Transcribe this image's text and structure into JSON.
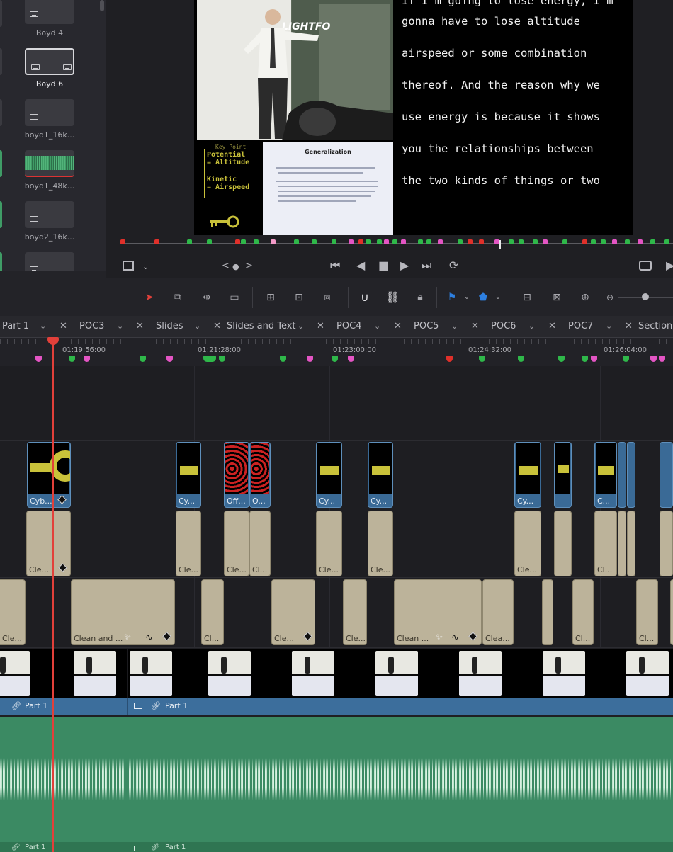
{
  "media_pool": {
    "items": [
      {
        "name": "Boyd 4",
        "kind": "subtitle"
      },
      {
        "name": "Boyd 6",
        "kind": "subtitle",
        "selected": true
      },
      {
        "name": "boyd1_16k...",
        "kind": "subtitle"
      },
      {
        "name": "boyd1_48k...",
        "kind": "audio"
      },
      {
        "name": "boyd2_16k...",
        "kind": "subtitle"
      }
    ]
  },
  "viewer": {
    "captions": [
      "If I'm going to lose energy, I'm",
      "gonna have to lose altitude",
      "airspeed or some combination",
      "thereof. And the reason why we",
      "use energy is because it shows",
      "you the relationships between",
      "the two kinds of things or two"
    ],
    "slide": {
      "title": "Generalization",
      "key_point": "Key Point",
      "potential": "Potential",
      "eq_altitude": "= Altitude",
      "kinetic": "Kinetic",
      "eq_airspeed": "= Airspeed"
    }
  },
  "transport": {
    "prev_marker": "<",
    "next_marker": ">",
    "dot": "●"
  },
  "timeline": {
    "tabs": [
      {
        "label": "Part 1"
      },
      {
        "label": "POC3"
      },
      {
        "label": "Slides"
      },
      {
        "label": "Slides and Text"
      },
      {
        "label": "POC4"
      },
      {
        "label": "POC5"
      },
      {
        "label": "POC6"
      },
      {
        "label": "POC7"
      },
      {
        "label": "Section"
      }
    ],
    "timecodes": [
      "01:19:56:00",
      "01:21:28:00",
      "01:23:00:00",
      "01:24:32:00",
      "01:26:04:00"
    ],
    "fusion_labels": [
      "Cyb...",
      "Cy...",
      "Off...",
      "O...",
      "Cy...",
      "Cy...",
      "Cy...",
      "C..."
    ],
    "title_labels_v3": [
      "Cle...",
      "Cle...",
      "Cle...",
      "Cl...",
      "Cle...",
      "Cle...",
      "Cle...",
      "Cl..."
    ],
    "title_labels_v2": [
      "Cle...",
      "Clean and ...",
      "Cl...",
      "Cle...",
      "Cle...",
      "Clean ...",
      "Clea...",
      "Cl...",
      "Cl..."
    ],
    "video_clip_name": "Part 1",
    "audio_clip_name": "Part 1"
  },
  "colors": {
    "playhead": "#e2403a",
    "marker_green": "#2fb84a",
    "marker_pink": "#e455c4",
    "marker_red": "#e0302a",
    "video_namebar": "#3c6e9c",
    "audio_track": "#3b8a63"
  }
}
